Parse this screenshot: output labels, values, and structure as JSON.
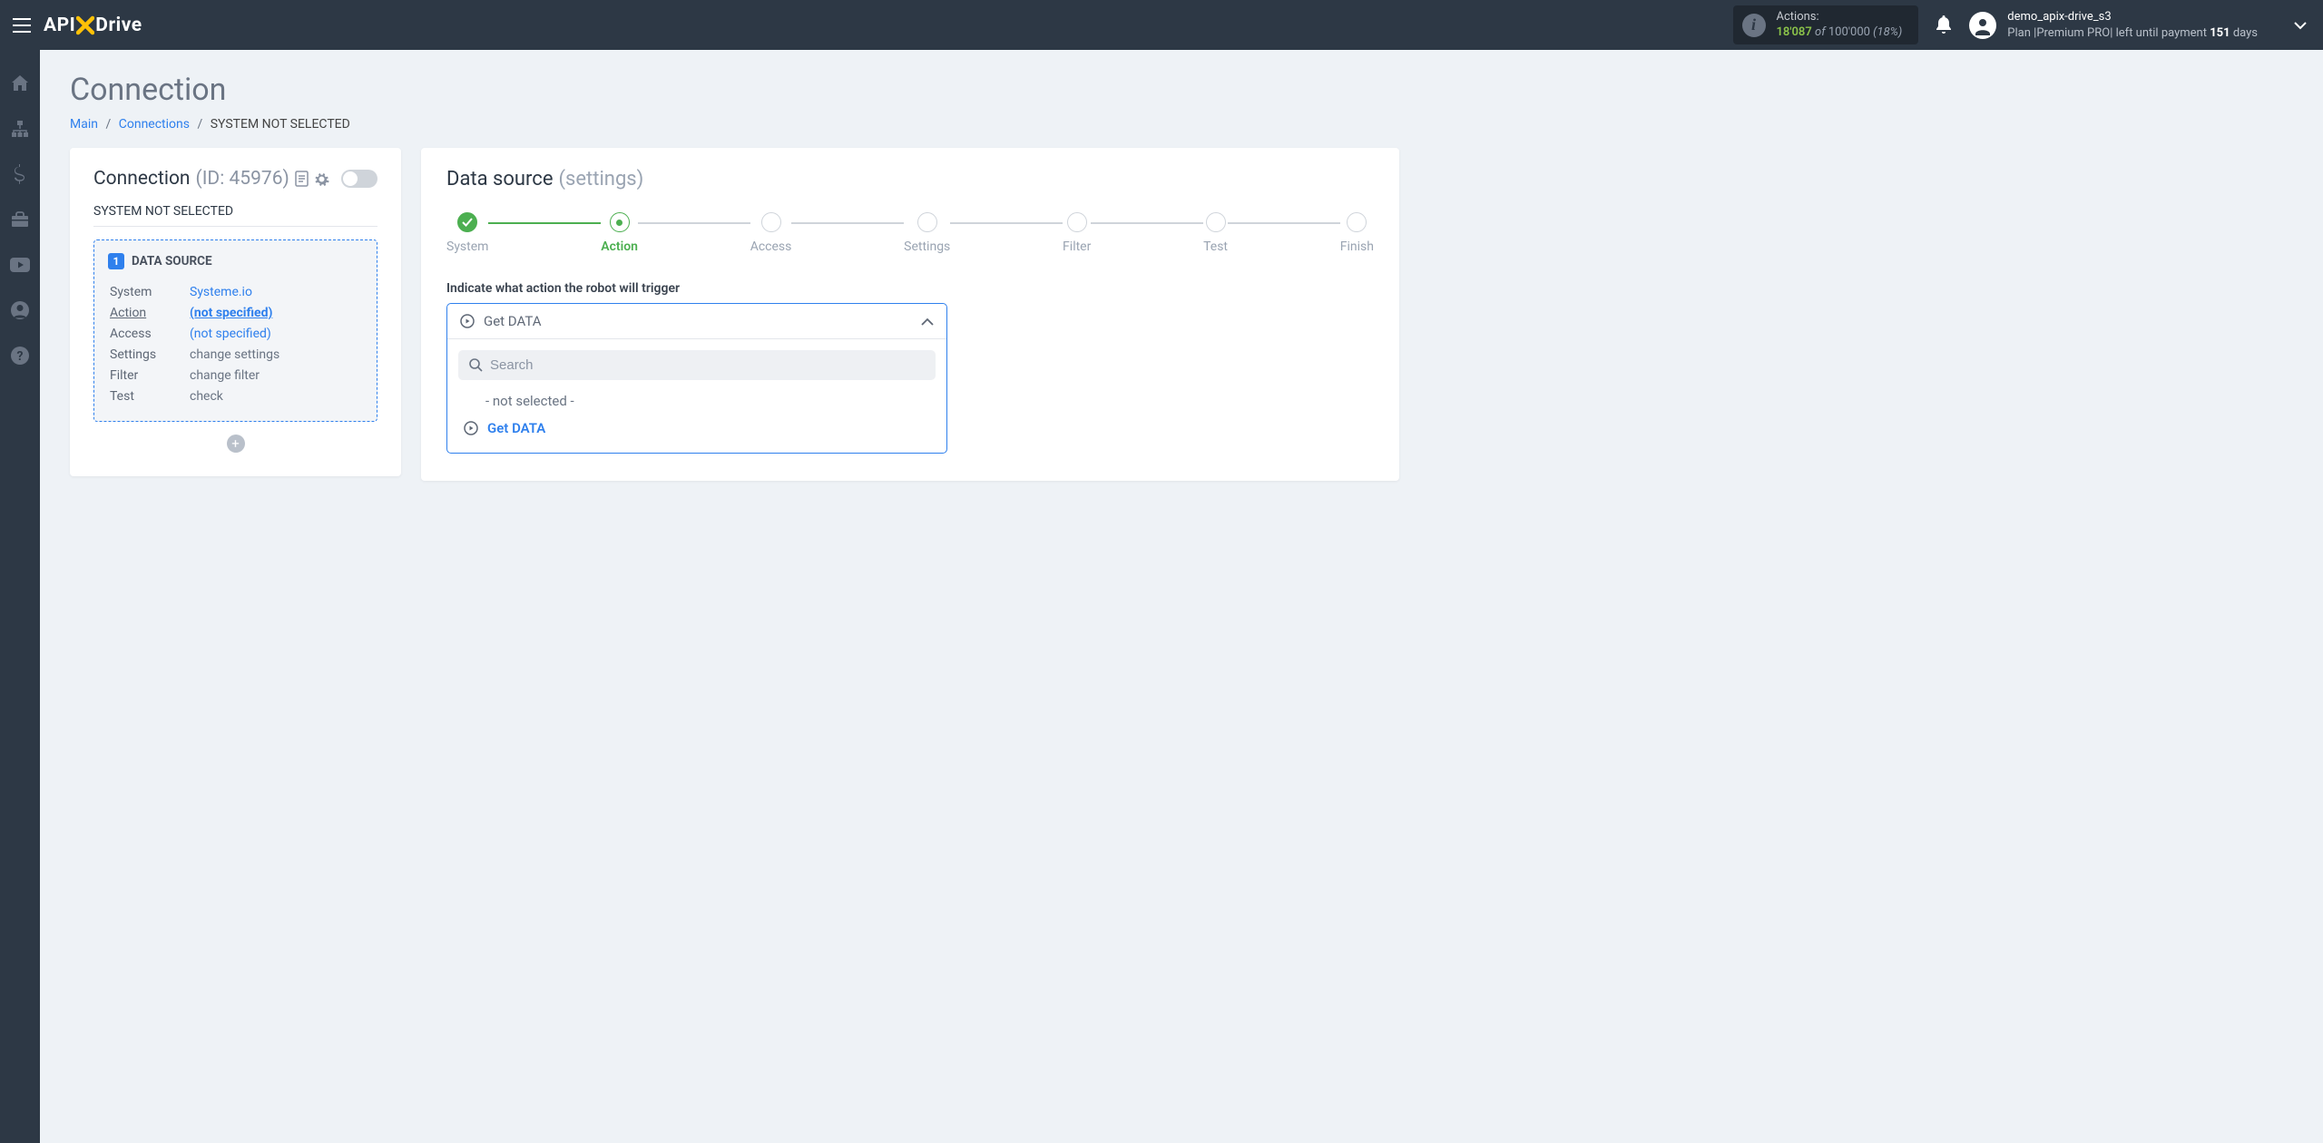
{
  "header": {
    "logo_parts": {
      "api": "API",
      "x": "X",
      "drive": "Drive"
    },
    "actions": {
      "label": "Actions:",
      "used": "18'087",
      "of": "of",
      "total": "100'000",
      "pct": "(18%)"
    },
    "user": {
      "name": "demo_apix-drive_s3",
      "plan_prefix": "Plan ",
      "plan_name": "|Premium PRO|",
      "plan_mid": " left until payment ",
      "days": "151",
      "days_suffix": " days"
    }
  },
  "page": {
    "title": "Connection",
    "breadcrumb": {
      "main": "Main",
      "connections": "Connections",
      "current": "SYSTEM NOT SELECTED"
    }
  },
  "left": {
    "title": "Connection",
    "id_label": "(ID: 45976)",
    "subhead": "SYSTEM NOT SELECTED",
    "ds": {
      "badge": "1",
      "title": "DATA SOURCE",
      "rows": {
        "system": {
          "label": "System",
          "value": "Systeme.io"
        },
        "action": {
          "label": "Action",
          "value": "(not specified)"
        },
        "access": {
          "label": "Access",
          "value": "(not specified)"
        },
        "settings": {
          "label": "Settings",
          "value": "change settings"
        },
        "filter": {
          "label": "Filter",
          "value": "change filter"
        },
        "test": {
          "label": "Test",
          "value": "check"
        }
      }
    }
  },
  "right": {
    "title": "Data source",
    "subtitle": "(settings)",
    "steps": {
      "s0": "System",
      "s1": "Action",
      "s2": "Access",
      "s3": "Settings",
      "s4": "Filter",
      "s5": "Test",
      "s6": "Finish"
    },
    "field_label": "Indicate what action the robot will trigger",
    "dropdown": {
      "selected": "Get DATA",
      "search_placeholder": "Search",
      "option_placeholder": "- not selected -",
      "option_get": "Get DATA"
    }
  }
}
